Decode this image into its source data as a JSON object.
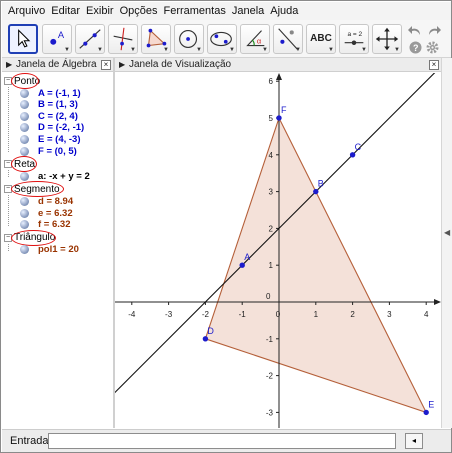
{
  "menu": [
    "Arquivo",
    "Editar",
    "Exibir",
    "Opções",
    "Ferramentas",
    "Janela",
    "Ajuda"
  ],
  "toolbar": {
    "tools": [
      {
        "name": "move-tool-button",
        "icon": "arrow-pointer-icon",
        "active": true
      },
      {
        "name": "point-tool-button",
        "icon": "point-icon",
        "label": "A"
      },
      {
        "name": "line-tool-button",
        "icon": "line-through-points-icon"
      },
      {
        "name": "perpendicular-line-tool-button",
        "icon": "perpendicular-line-icon"
      },
      {
        "name": "polygon-tool-button",
        "icon": "polygon-icon"
      },
      {
        "name": "circle-tool-button",
        "icon": "circle-icon"
      },
      {
        "name": "conic-tool-button",
        "icon": "conic-icon"
      },
      {
        "name": "angle-tool-button",
        "icon": "angle-icon",
        "label": "α"
      },
      {
        "name": "reflect-tool-button",
        "icon": "reflect-icon"
      },
      {
        "name": "text-tool-button",
        "icon": "text-icon",
        "label": "ABC"
      },
      {
        "name": "slider-tool-button",
        "icon": "slider-icon",
        "label": "a = 2"
      },
      {
        "name": "move-graphics-view-button",
        "icon": "move-cross-icon"
      }
    ],
    "undo_icon": "undo-icon",
    "redo_icon": "redo-icon",
    "help_icon": "help-icon",
    "settings_icon": "gear-icon"
  },
  "algebra_view": {
    "title": "Janela de Álgebra",
    "categories": [
      {
        "label": "Ponto",
        "items": [
          {
            "text": "A = (-1, 1)",
            "color": "#0000cc"
          },
          {
            "text": "B = (1, 3)",
            "color": "#0000cc"
          },
          {
            "text": "C = (2, 4)",
            "color": "#0000cc"
          },
          {
            "text": "D = (-2, -1)",
            "color": "#0000cc"
          },
          {
            "text": "E = (4, -3)",
            "color": "#0000cc"
          },
          {
            "text": "F = (0, 5)",
            "color": "#0000cc"
          }
        ]
      },
      {
        "label": "Reta",
        "items": [
          {
            "text": "a: -x + y = 2",
            "color": "#000000"
          }
        ]
      },
      {
        "label": "Segmento",
        "items": [
          {
            "text": "d = 8.94",
            "color": "#993300"
          },
          {
            "text": "e = 6.32",
            "color": "#993300"
          },
          {
            "text": "f = 6.32",
            "color": "#993300"
          }
        ]
      },
      {
        "label": "Triângulo",
        "items": [
          {
            "text": "pol1 = 20",
            "color": "#993300"
          }
        ]
      }
    ]
  },
  "graphics_view": {
    "title": "Janela de Visualização",
    "x_ticks": [
      "-4",
      "-3",
      "-2",
      "-1",
      "0",
      "1",
      "2",
      "3",
      "4"
    ],
    "y_ticks": [
      "-3",
      "-2",
      "-1",
      "0",
      "1",
      "2",
      "3",
      "4",
      "5",
      "6"
    ],
    "points": [
      {
        "label": "A",
        "x": -1,
        "y": 1
      },
      {
        "label": "B",
        "x": 1,
        "y": 3
      },
      {
        "label": "C",
        "x": 2,
        "y": 4
      },
      {
        "label": "D",
        "x": -2,
        "y": -1
      },
      {
        "label": "E",
        "x": 4,
        "y": -3
      },
      {
        "label": "F",
        "x": 0,
        "y": 5
      }
    ],
    "line": {
      "label": "a",
      "equation": "-x + y = 2"
    },
    "triangle": {
      "vertices": [
        "D",
        "E",
        "F"
      ],
      "fill": "#f2dcd2",
      "stroke": "#b5603a"
    },
    "point_color": "#1c1ccc",
    "axes_color": "#222222"
  },
  "input_bar": {
    "label": "Entrada:",
    "value": "",
    "button_icon": "input-help-icon"
  }
}
